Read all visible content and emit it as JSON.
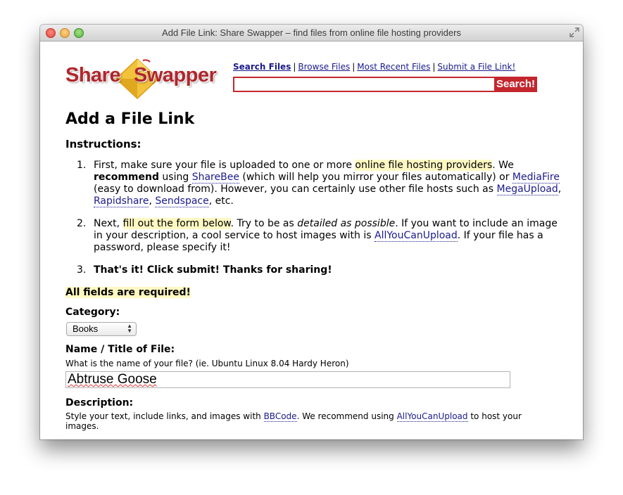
{
  "window": {
    "title": "Add File Link: Share Swapper – find files from online file hosting providers"
  },
  "logo": {
    "part1": "Share",
    "part2": "Swapper"
  },
  "nav": {
    "items": [
      "Search Files",
      "Browse Files",
      "Most Recent Files",
      "Submit a File Link!"
    ],
    "separator": "|"
  },
  "search": {
    "value": "",
    "button_label": "Search!"
  },
  "page": {
    "title": "Add a File Link",
    "instructions_heading": "Instructions:"
  },
  "steps": {
    "step1": {
      "num": "1.",
      "t1": "First, make sure your file is uploaded to one or more ",
      "hl": "online file hosting providers",
      "t2": ". We ",
      "bold": "recommend",
      "t3": " using ",
      "l1": "ShareBee",
      "t4": " (which will help you mirror your files automatically) or ",
      "l2": "MediaFire",
      "t5": " (easy to download from). However, you can certainly use other file hosts such as ",
      "l3": "MegaUpload",
      "c1": ", ",
      "l4": "Rapidshare",
      "c2": ", ",
      "l5": "Sendspace",
      "t6": ", etc."
    },
    "step2": {
      "num": "2.",
      "t1": "Next, ",
      "hl": "fill out the form below",
      "t2": ". Try to be as ",
      "em": "detailed as possible",
      "t3": ". If you want to include an image in your description, a cool service to host images with is ",
      "l1": "AllYouCanUpload",
      "t4": ". If your file has a password, please specify it!"
    },
    "step3": {
      "num": "3.",
      "text": "That's it! Click submit! Thanks for sharing!"
    }
  },
  "form": {
    "required_note": "All fields are required!",
    "category_label": "Category:",
    "category_value": "Books",
    "name_label": "Name / Title of File:",
    "name_help": "What is the name of your file? (ie. Ubuntu Linux 8.04 Hardy Heron)",
    "name_value": "Abtruse Goose",
    "description_label": "Description:",
    "description_help": {
      "t1": "Style your text, include links, and images with ",
      "l1": "BBCode",
      "t2": ". We recommend using ",
      "l2": "AllYouCanUpload",
      "t3": " to host your images."
    }
  },
  "colors": {
    "brand_red": "#c4262e",
    "link": "#1a1a8c",
    "highlight": "#fff8c2"
  }
}
